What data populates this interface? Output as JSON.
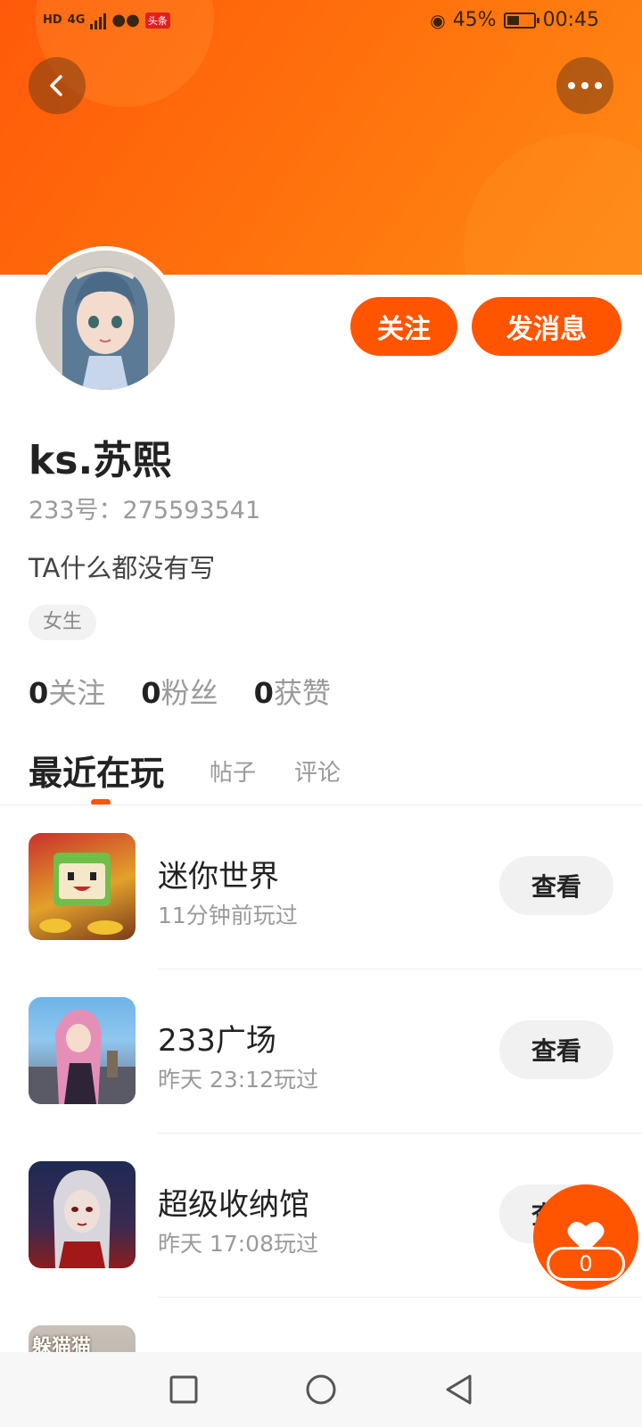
{
  "status_bar": {
    "hd": "HD",
    "network": "4G",
    "app_badge": "头条",
    "battery_percent": "45%",
    "battery_level": 0.45,
    "time": "00:45"
  },
  "header": {
    "back_icon": "chevron-left-icon",
    "more_icon": "more-dots-icon",
    "accent_color": "#ff5500"
  },
  "profile": {
    "follow_label": "关注",
    "message_label": "发消息",
    "username": "ks.苏熙",
    "account_id": "233号：275593541",
    "bio": "TA什么都没有写",
    "gender_tag": "女生",
    "stats": {
      "following_count": "0",
      "following_label": "关注",
      "followers_count": "0",
      "followers_label": "粉丝",
      "likes_count": "0",
      "likes_label": "获赞"
    }
  },
  "tabs": {
    "recent": "最近在玩",
    "posts": "帖子",
    "comments": "评论"
  },
  "games": [
    {
      "name": "迷你世界",
      "time": "11分钟前玩过",
      "button": "查看"
    },
    {
      "name": "233广场",
      "time": "昨天 23:12玩过",
      "button": "查看"
    },
    {
      "name": "超级收纳馆",
      "time": "昨天 17:08玩过",
      "button": "查看"
    },
    {
      "icon_text": "躲猫猫"
    }
  ],
  "like_fab": {
    "count": "0",
    "icon": "heart-icon"
  },
  "nav_bar": {
    "recent_icon": "square-icon",
    "home_icon": "circle-icon",
    "back_icon": "triangle-back-icon"
  }
}
